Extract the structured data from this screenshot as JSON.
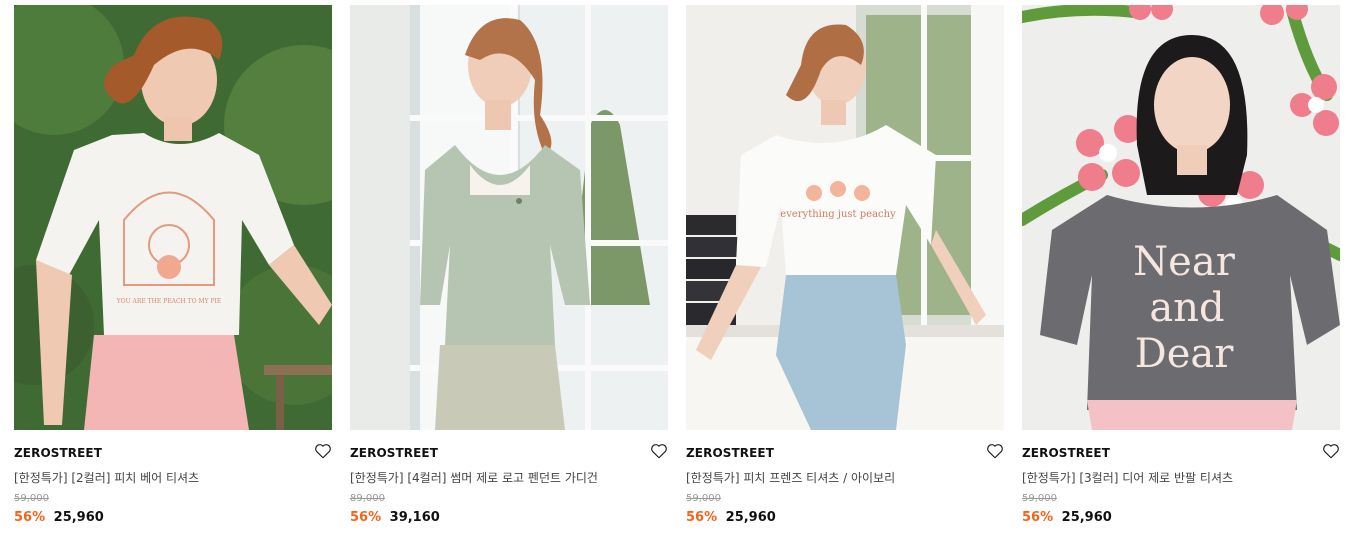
{
  "colors": {
    "discount": "#f4641e",
    "original_price": "#9a9a9a"
  },
  "products": [
    {
      "brand": "ZEROSTREET",
      "title": "[한정특가] [2컬러] 피치 베어 티셔츠",
      "original_price": "59,000",
      "discount": "56%",
      "price": "25,960",
      "shirt_print": "YOU ARE THE PEACH TO MY PIE"
    },
    {
      "brand": "ZEROSTREET",
      "title": "[한정특가] [4컬러] 썸머 제로 로고 펜던트 가디건",
      "original_price": "89,000",
      "discount": "56%",
      "price": "39,160"
    },
    {
      "brand": "ZEROSTREET",
      "title": "[한정특가] 피치 프렌즈 티셔츠 / 아이보리",
      "original_price": "59,000",
      "discount": "56%",
      "price": "25,960",
      "shirt_print": "everything just peachy"
    },
    {
      "brand": "ZEROSTREET",
      "title": "[한정특가] [3컬러] 디어 제로 반팔 티셔츠",
      "original_price": "59,000",
      "discount": "56%",
      "price": "25,960",
      "shirt_print": [
        "Near",
        "and",
        "Dear"
      ]
    }
  ]
}
